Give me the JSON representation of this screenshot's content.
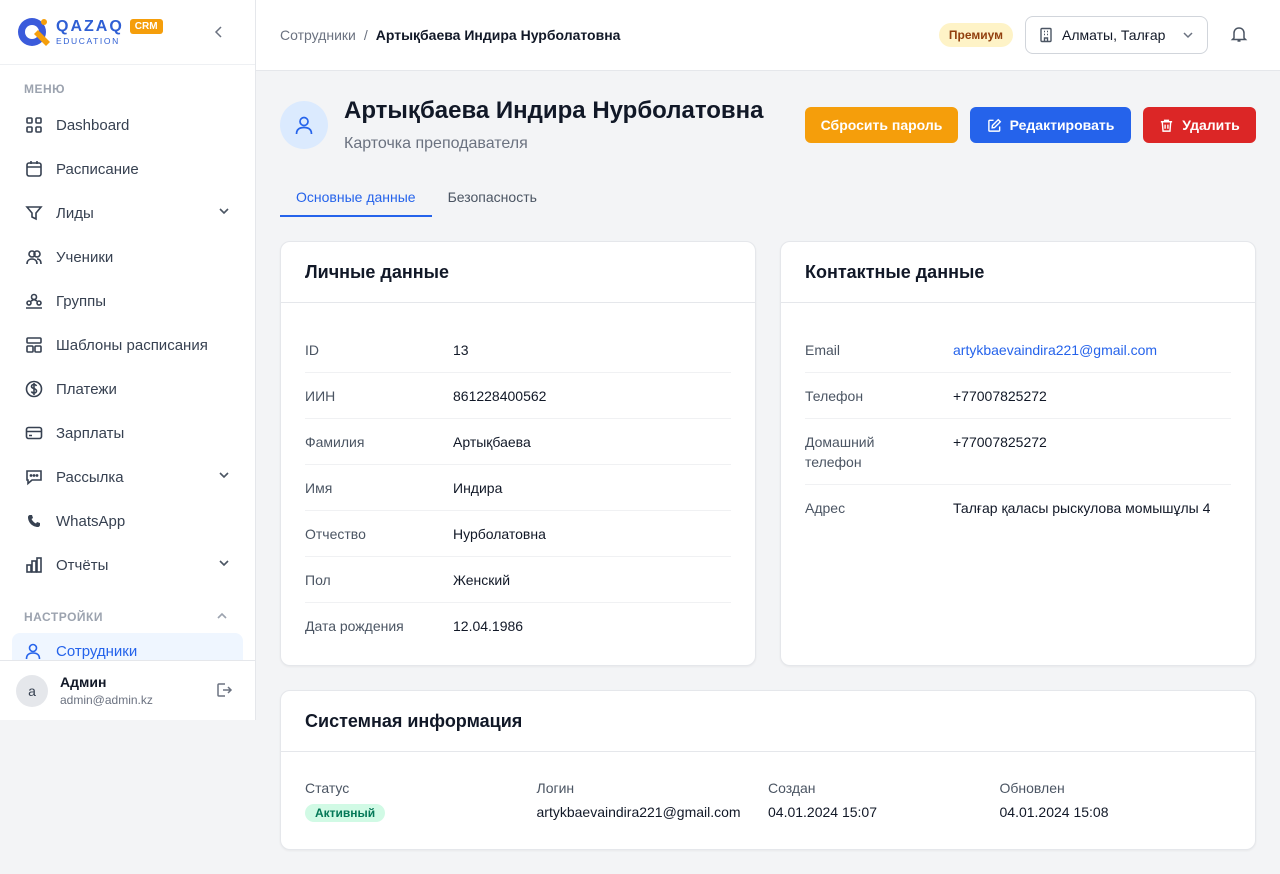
{
  "brand": {
    "name": "QAZAQ",
    "sub": "EDUCATION",
    "badge": "CRM"
  },
  "sidebar": {
    "menu_label": "МЕНЮ",
    "items": [
      {
        "label": "Dashboard",
        "icon": "dashboard-icon"
      },
      {
        "label": "Расписание",
        "icon": "calendar-icon"
      },
      {
        "label": "Лиды",
        "icon": "funnel-icon"
      },
      {
        "label": "Ученики",
        "icon": "students-icon"
      },
      {
        "label": "Группы",
        "icon": "groups-icon"
      },
      {
        "label": "Шаблоны расписания",
        "icon": "template-icon"
      },
      {
        "label": "Платежи",
        "icon": "dollar-icon"
      },
      {
        "label": "Зарплаты",
        "icon": "card-icon"
      },
      {
        "label": "Рассылка",
        "icon": "chat-icon"
      },
      {
        "label": "WhatsApp",
        "icon": "phone-icon"
      },
      {
        "label": "Отчёты",
        "icon": "chart-icon"
      }
    ],
    "settings_label": "НАСТРОЙКИ",
    "active_item": "Сотрудники",
    "user": {
      "initial": "a",
      "name": "Админ",
      "email": "admin@admin.kz"
    }
  },
  "header": {
    "breadcrumb_parent": "Сотрудники",
    "breadcrumb_sep": "/",
    "breadcrumb_current": "Артықбаева Индира Нурболатовна",
    "plan_badge": "Премиум",
    "branch": "Алматы, Талғар"
  },
  "profile": {
    "name": "Артықбаева Индира Нурболатовна",
    "subtitle": "Карточка преподавателя",
    "actions": {
      "reset": "Сбросить пароль",
      "edit": "Редактировать",
      "delete": "Удалить"
    }
  },
  "tabs": [
    "Основные данные",
    "Безопасность"
  ],
  "personal": {
    "title": "Личные данные",
    "rows": [
      {
        "label": "ID",
        "value": "13"
      },
      {
        "label": "ИИН",
        "value": "861228400562"
      },
      {
        "label": "Фамилия",
        "value": "Артықбаева"
      },
      {
        "label": "Имя",
        "value": "Индира"
      },
      {
        "label": "Отчество",
        "value": "Нурболатовна"
      },
      {
        "label": "Пол",
        "value": "Женский"
      },
      {
        "label": "Дата рождения",
        "value": "12.04.1986"
      }
    ]
  },
  "contact": {
    "title": "Контактные данные",
    "rows": [
      {
        "label": "Email",
        "value": "artykbaevaindira221@gmail.com"
      },
      {
        "label": "Телефон",
        "value": "+77007825272"
      },
      {
        "label": "Домашний телефон",
        "value": "+77007825272"
      },
      {
        "label": "Адрес",
        "value": "Талғар қаласы рыскулова момышұлы 4"
      }
    ]
  },
  "system": {
    "title": "Системная информация",
    "status_label": "Статус",
    "status_value": "Активный",
    "login_label": "Логин",
    "login_value": "artykbaevaindira221@gmail.com",
    "created_label": "Создан",
    "created_value": "04.01.2024 15:07",
    "updated_label": "Обновлен",
    "updated_value": "04.01.2024 15:08"
  },
  "colors": {
    "primary": "#2563eb",
    "warning": "#f59e0b",
    "danger": "#dc2626",
    "success_bg": "#d1fae5"
  }
}
